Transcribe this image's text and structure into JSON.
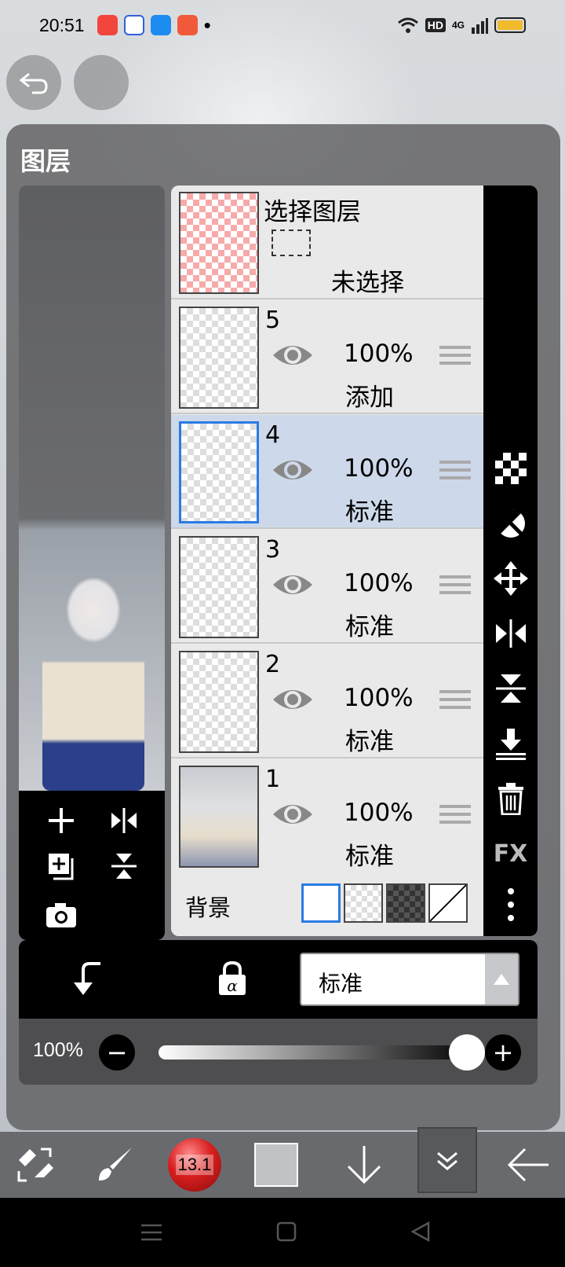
{
  "status_bar": {
    "time": "20:51",
    "dot": "•",
    "hd": "HD",
    "network": "4G",
    "app_icons": [
      "video-app-icon",
      "baidu-app-icon",
      "browser-app-icon",
      "game-app-icon"
    ]
  },
  "panel": {
    "title": "图层"
  },
  "selection_layer": {
    "title": "选择图层",
    "status": "未选择"
  },
  "layers": [
    {
      "number": "5",
      "opacity": "100%",
      "blend": "添加",
      "selected": false
    },
    {
      "number": "4",
      "opacity": "100%",
      "blend": "标准",
      "selected": true
    },
    {
      "number": "3",
      "opacity": "100%",
      "blend": "标准",
      "selected": false
    },
    {
      "number": "2",
      "opacity": "100%",
      "blend": "标准",
      "selected": false
    },
    {
      "number": "1",
      "opacity": "100%",
      "blend": "标准",
      "selected": false
    }
  ],
  "background": {
    "label": "背景",
    "options": [
      "white",
      "transparent-light",
      "transparent-dark",
      "none"
    ]
  },
  "side_tools": {
    "fx_label": "FX"
  },
  "blend_bar": {
    "mode": "标准"
  },
  "opacity_bar": {
    "label": "100%",
    "minus": "−",
    "plus": "+",
    "level": 1.0
  },
  "toolbar": {
    "brush_size": "13.1"
  },
  "colors": {
    "accent": "#2a7be4",
    "selected_row": "#cdd9ea",
    "brush_red": "#d81e1e",
    "battery": "#f2bb2c"
  }
}
